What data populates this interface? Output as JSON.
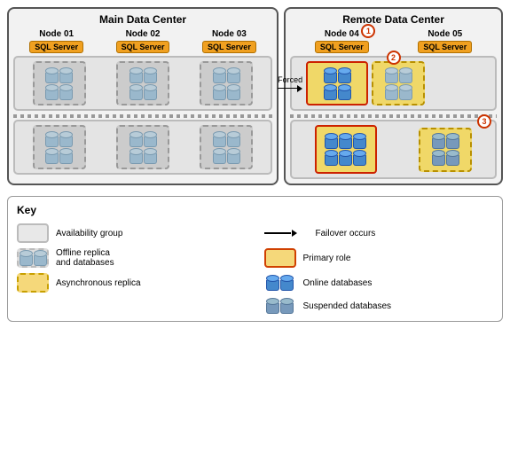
{
  "main_dc": {
    "title": "Main Data Center",
    "nodes": [
      {
        "label": "Node 01",
        "sql": "SQL Server"
      },
      {
        "label": "Node 02",
        "sql": "SQL Server"
      },
      {
        "label": "Node 03",
        "sql": "SQL Server"
      }
    ]
  },
  "remote_dc": {
    "title": "Remote Data Center",
    "nodes": [
      {
        "label": "Node 04",
        "sql": "SQL Server",
        "badge": "1"
      },
      {
        "label": "Node 05",
        "sql": "SQL Server"
      }
    ]
  },
  "labels": {
    "forced": "Forced",
    "badge2": "2",
    "badge3": "3"
  },
  "legend": {
    "title": "Key",
    "items": [
      {
        "icon": "ag",
        "text": "Availability group"
      },
      {
        "icon": "arrow",
        "text": "Failover occurs"
      },
      {
        "icon": "offline",
        "text": "Offline replica\nand databases"
      },
      {
        "icon": "primary",
        "text": "Primary role"
      },
      {
        "icon": "async",
        "text": "Asynchronous replica"
      },
      {
        "icon": "online",
        "text": "Online databases"
      },
      {
        "icon": "blank",
        "text": ""
      },
      {
        "icon": "suspended",
        "text": "Suspended databases"
      }
    ]
  }
}
